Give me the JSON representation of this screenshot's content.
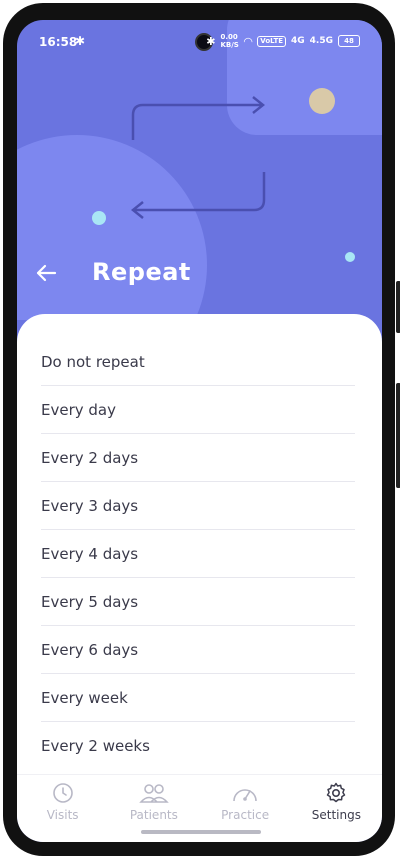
{
  "status_bar": {
    "time": "16:58",
    "network_speed": "0.00",
    "network_unit": "KB/S",
    "volte": "VoLTE",
    "sim1": "4G",
    "sim2": "4.5G",
    "battery": "48"
  },
  "header": {
    "title": "Repeat"
  },
  "options": [
    {
      "label": "Do not repeat"
    },
    {
      "label": "Every day"
    },
    {
      "label": "Every 2 days"
    },
    {
      "label": "Every 3 days"
    },
    {
      "label": "Every 4 days"
    },
    {
      "label": "Every 5 days"
    },
    {
      "label": "Every 6 days"
    },
    {
      "label": "Every week"
    },
    {
      "label": "Every 2 weeks"
    }
  ],
  "tabs": [
    {
      "label": "Visits",
      "icon": "clock-icon"
    },
    {
      "label": "Patients",
      "icon": "people-icon"
    },
    {
      "label": "Practice",
      "icon": "gauge-icon"
    },
    {
      "label": "Settings",
      "icon": "gear-icon"
    }
  ],
  "colors": {
    "header_bg": "#6a74e0",
    "deco_circle": "#7d87ef",
    "accent_dark": "#4a4fb0",
    "dot_tan": "#d9c9a8",
    "dot_cyan": "#a9e6f5",
    "active_tab": "#3d3d4d",
    "inactive_tab": "#b8b8c6"
  }
}
